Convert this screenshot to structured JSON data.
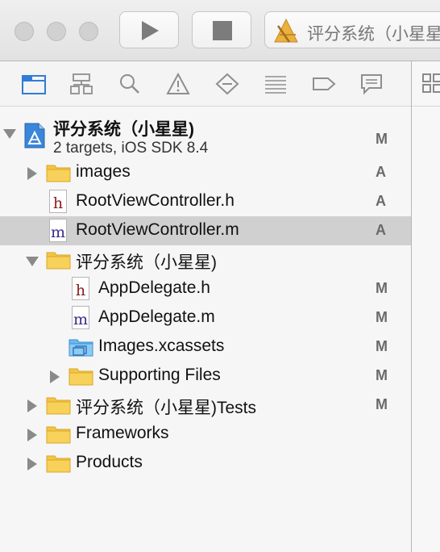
{
  "toolbar": {
    "scheme_name": "评分系统（小星星"
  },
  "navigator": {
    "icons": [
      "project-navigator-icon",
      "symbol-navigator-icon",
      "find-navigator-icon",
      "issue-navigator-icon",
      "test-navigator-icon",
      "debug-navigator-icon",
      "breakpoint-navigator-icon",
      "report-navigator-icon"
    ]
  },
  "tree": {
    "project": {
      "name": "评分系统（小星星)",
      "subtitle": "2 targets, iOS SDK 8.4",
      "status": "M"
    },
    "items": [
      {
        "label": "images",
        "status": "A"
      },
      {
        "label": "RootViewController.h",
        "status": "A"
      },
      {
        "label": "RootViewController.m",
        "status": "A"
      },
      {
        "label": "评分系统（小星星)",
        "status": ""
      },
      {
        "label": "AppDelegate.h",
        "status": "M"
      },
      {
        "label": "AppDelegate.m",
        "status": "M"
      },
      {
        "label": "Images.xcassets",
        "status": "M"
      },
      {
        "label": "Supporting Files",
        "status": "M"
      },
      {
        "label": "评分系统（小星星)Tests",
        "status": "M"
      },
      {
        "label": "Frameworks",
        "status": ""
      },
      {
        "label": "Products",
        "status": ""
      }
    ]
  },
  "colors": {
    "selection": "#d0d0d0",
    "active_icon": "#2f7dd6",
    "inactive_icon": "#8e8e8e",
    "folder": "#f5c542",
    "header_letter": "#8b1a1a",
    "impl_letter": "#3b2a8a"
  }
}
